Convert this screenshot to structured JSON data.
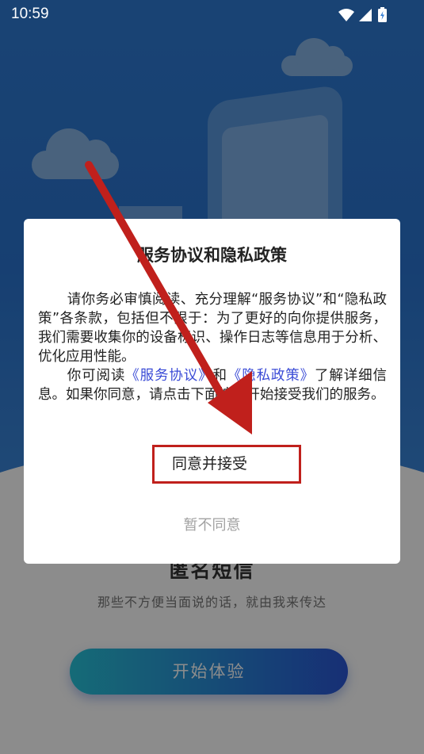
{
  "status_bar": {
    "time": "10:59",
    "icons": [
      "wifi-icon",
      "signal-icon",
      "battery-charging-icon"
    ]
  },
  "background": {
    "title": "匿名短信",
    "subtitle": "那些不方便当面说的话，就由我来传达",
    "start_button": "开始体验",
    "colors": {
      "header_blue": "#2f7bd4",
      "button_start": "#27c3d9",
      "button_end": "#2a56d6"
    }
  },
  "dialog": {
    "title": "服务协议和隐私政策",
    "paragraph1": "请你务必审慎阅读、充分理解“服务协议”和“隐私政策”各条款，包括但不限于：为了更好的向你提供服务，我们需要收集你的设备标识、操作日志等信息用于分析、优化应用性能。",
    "paragraph2_prefix": "你可阅读",
    "link_service": "《服务协议》",
    "paragraph2_and": "和",
    "link_privacy": "《隐私政策》",
    "paragraph2_suffix": "了解详细信息。如果你同意，请点击下面按钮开始接受我们的服务。",
    "accept_button": "同意并接受",
    "decline_button": "暂不同意",
    "colors": {
      "link": "#3a4bd6",
      "highlight_box": "#c0201c",
      "decline_text": "#a2a2a2"
    }
  },
  "annotation": {
    "arrow_color": "#c0201c",
    "arrow_icon": "arrow-pointing-to-accept-icon"
  }
}
